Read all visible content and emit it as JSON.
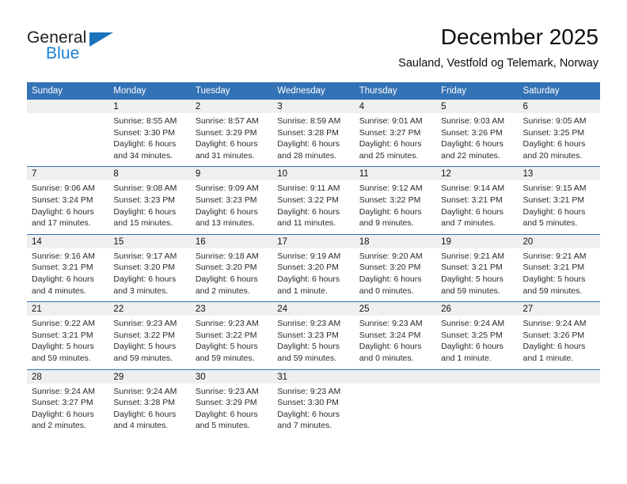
{
  "brand": {
    "name_part1": "General",
    "name_part2": "Blue",
    "triangle_icon": "triangle-icon",
    "accent_color": "#1b72bd"
  },
  "header": {
    "title": "December 2025",
    "location": "Sauland, Vestfold og Telemark, Norway"
  },
  "colors": {
    "header_blue": "#3372b4",
    "daynum_gray": "#efefef",
    "text": "#2a2a2a"
  },
  "weekdays": [
    "Sunday",
    "Monday",
    "Tuesday",
    "Wednesday",
    "Thursday",
    "Friday",
    "Saturday"
  ],
  "weeks": [
    [
      {
        "day": "",
        "lines": [
          "",
          "",
          "",
          ""
        ]
      },
      {
        "day": "1",
        "lines": [
          "Sunrise: 8:55 AM",
          "Sunset: 3:30 PM",
          "Daylight: 6 hours",
          "and 34 minutes."
        ]
      },
      {
        "day": "2",
        "lines": [
          "Sunrise: 8:57 AM",
          "Sunset: 3:29 PM",
          "Daylight: 6 hours",
          "and 31 minutes."
        ]
      },
      {
        "day": "3",
        "lines": [
          "Sunrise: 8:59 AM",
          "Sunset: 3:28 PM",
          "Daylight: 6 hours",
          "and 28 minutes."
        ]
      },
      {
        "day": "4",
        "lines": [
          "Sunrise: 9:01 AM",
          "Sunset: 3:27 PM",
          "Daylight: 6 hours",
          "and 25 minutes."
        ]
      },
      {
        "day": "5",
        "lines": [
          "Sunrise: 9:03 AM",
          "Sunset: 3:26 PM",
          "Daylight: 6 hours",
          "and 22 minutes."
        ]
      },
      {
        "day": "6",
        "lines": [
          "Sunrise: 9:05 AM",
          "Sunset: 3:25 PM",
          "Daylight: 6 hours",
          "and 20 minutes."
        ]
      }
    ],
    [
      {
        "day": "7",
        "lines": [
          "Sunrise: 9:06 AM",
          "Sunset: 3:24 PM",
          "Daylight: 6 hours",
          "and 17 minutes."
        ]
      },
      {
        "day": "8",
        "lines": [
          "Sunrise: 9:08 AM",
          "Sunset: 3:23 PM",
          "Daylight: 6 hours",
          "and 15 minutes."
        ]
      },
      {
        "day": "9",
        "lines": [
          "Sunrise: 9:09 AM",
          "Sunset: 3:23 PM",
          "Daylight: 6 hours",
          "and 13 minutes."
        ]
      },
      {
        "day": "10",
        "lines": [
          "Sunrise: 9:11 AM",
          "Sunset: 3:22 PM",
          "Daylight: 6 hours",
          "and 11 minutes."
        ]
      },
      {
        "day": "11",
        "lines": [
          "Sunrise: 9:12 AM",
          "Sunset: 3:22 PM",
          "Daylight: 6 hours",
          "and 9 minutes."
        ]
      },
      {
        "day": "12",
        "lines": [
          "Sunrise: 9:14 AM",
          "Sunset: 3:21 PM",
          "Daylight: 6 hours",
          "and 7 minutes."
        ]
      },
      {
        "day": "13",
        "lines": [
          "Sunrise: 9:15 AM",
          "Sunset: 3:21 PM",
          "Daylight: 6 hours",
          "and 5 minutes."
        ]
      }
    ],
    [
      {
        "day": "14",
        "lines": [
          "Sunrise: 9:16 AM",
          "Sunset: 3:21 PM",
          "Daylight: 6 hours",
          "and 4 minutes."
        ]
      },
      {
        "day": "15",
        "lines": [
          "Sunrise: 9:17 AM",
          "Sunset: 3:20 PM",
          "Daylight: 6 hours",
          "and 3 minutes."
        ]
      },
      {
        "day": "16",
        "lines": [
          "Sunrise: 9:18 AM",
          "Sunset: 3:20 PM",
          "Daylight: 6 hours",
          "and 2 minutes."
        ]
      },
      {
        "day": "17",
        "lines": [
          "Sunrise: 9:19 AM",
          "Sunset: 3:20 PM",
          "Daylight: 6 hours",
          "and 1 minute."
        ]
      },
      {
        "day": "18",
        "lines": [
          "Sunrise: 9:20 AM",
          "Sunset: 3:20 PM",
          "Daylight: 6 hours",
          "and 0 minutes."
        ]
      },
      {
        "day": "19",
        "lines": [
          "Sunrise: 9:21 AM",
          "Sunset: 3:21 PM",
          "Daylight: 5 hours",
          "and 59 minutes."
        ]
      },
      {
        "day": "20",
        "lines": [
          "Sunrise: 9:21 AM",
          "Sunset: 3:21 PM",
          "Daylight: 5 hours",
          "and 59 minutes."
        ]
      }
    ],
    [
      {
        "day": "21",
        "lines": [
          "Sunrise: 9:22 AM",
          "Sunset: 3:21 PM",
          "Daylight: 5 hours",
          "and 59 minutes."
        ]
      },
      {
        "day": "22",
        "lines": [
          "Sunrise: 9:23 AM",
          "Sunset: 3:22 PM",
          "Daylight: 5 hours",
          "and 59 minutes."
        ]
      },
      {
        "day": "23",
        "lines": [
          "Sunrise: 9:23 AM",
          "Sunset: 3:22 PM",
          "Daylight: 5 hours",
          "and 59 minutes."
        ]
      },
      {
        "day": "24",
        "lines": [
          "Sunrise: 9:23 AM",
          "Sunset: 3:23 PM",
          "Daylight: 5 hours",
          "and 59 minutes."
        ]
      },
      {
        "day": "25",
        "lines": [
          "Sunrise: 9:23 AM",
          "Sunset: 3:24 PM",
          "Daylight: 6 hours",
          "and 0 minutes."
        ]
      },
      {
        "day": "26",
        "lines": [
          "Sunrise: 9:24 AM",
          "Sunset: 3:25 PM",
          "Daylight: 6 hours",
          "and 1 minute."
        ]
      },
      {
        "day": "27",
        "lines": [
          "Sunrise: 9:24 AM",
          "Sunset: 3:26 PM",
          "Daylight: 6 hours",
          "and 1 minute."
        ]
      }
    ],
    [
      {
        "day": "28",
        "lines": [
          "Sunrise: 9:24 AM",
          "Sunset: 3:27 PM",
          "Daylight: 6 hours",
          "and 2 minutes."
        ]
      },
      {
        "day": "29",
        "lines": [
          "Sunrise: 9:24 AM",
          "Sunset: 3:28 PM",
          "Daylight: 6 hours",
          "and 4 minutes."
        ]
      },
      {
        "day": "30",
        "lines": [
          "Sunrise: 9:23 AM",
          "Sunset: 3:29 PM",
          "Daylight: 6 hours",
          "and 5 minutes."
        ]
      },
      {
        "day": "31",
        "lines": [
          "Sunrise: 9:23 AM",
          "Sunset: 3:30 PM",
          "Daylight: 6 hours",
          "and 7 minutes."
        ]
      },
      {
        "day": "",
        "lines": [
          "",
          "",
          "",
          ""
        ]
      },
      {
        "day": "",
        "lines": [
          "",
          "",
          "",
          ""
        ]
      },
      {
        "day": "",
        "lines": [
          "",
          "",
          "",
          ""
        ]
      }
    ]
  ]
}
